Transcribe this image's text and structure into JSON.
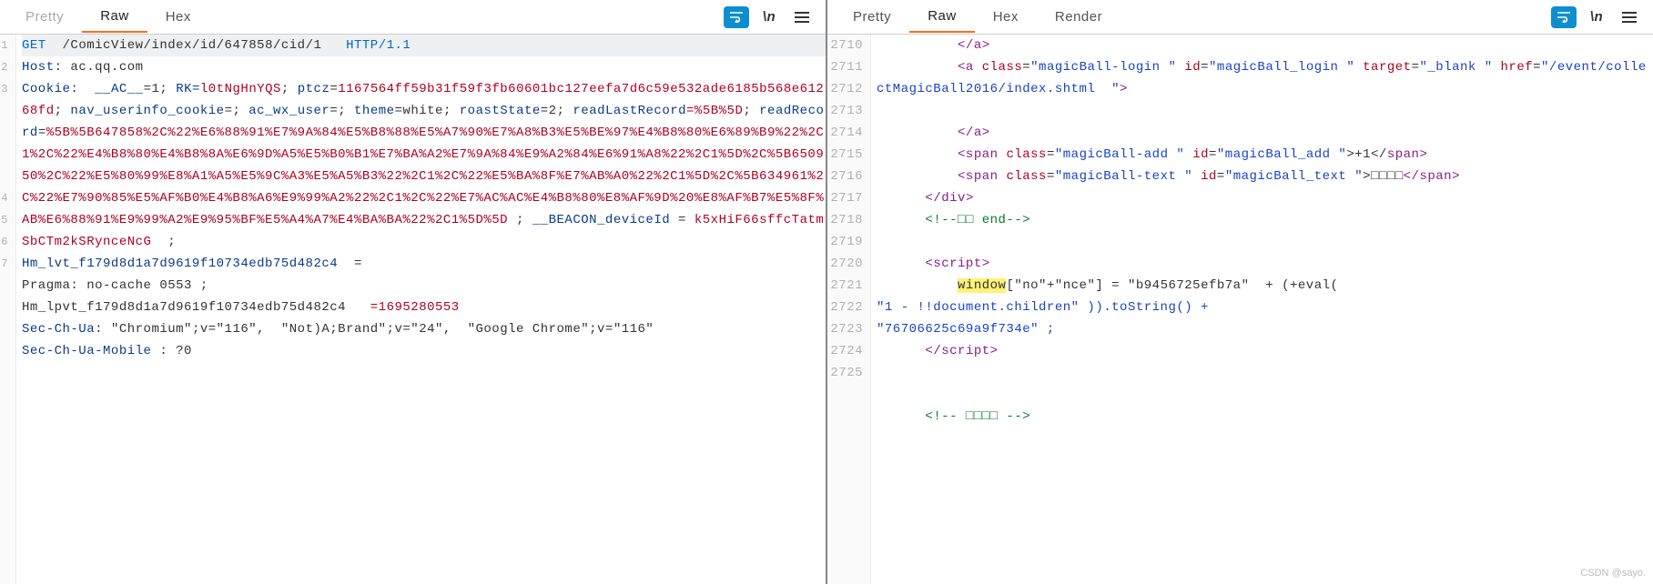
{
  "left": {
    "tabs": {
      "pretty": "Pretty",
      "raw": "Raw",
      "hex": "Hex"
    },
    "icons": {
      "wrap": "wrap-icon",
      "newline": "\\n",
      "menu": "☰"
    },
    "gutter": [
      "1",
      "2",
      "3",
      "4",
      "5",
      "6",
      "7"
    ],
    "req": {
      "method": "GET",
      "path": "/ComicView/index/id/647858/cid/1",
      "proto": "HTTP/1.1"
    },
    "headers": {
      "host_k": "Host",
      "host_v": "ac.qq.com",
      "cookie_k": "Cookie",
      "cookie_ac_k": "__AC__",
      "cookie_ac_v": "=1",
      "cookie_rk_k": "RK=",
      "cookie_rk_v": "l0tNgHnYQS",
      "cookie_ptcz_k": "ptcz",
      "cookie_ptcz_v": "1167564ff59b31f59f3fb60601bc127eefa7d6c59e532ade6185b568e61268fd",
      "cookie_nav_k": "nav_userinfo_cookie",
      "cookie_nav_v": "=;",
      "cookie_acwx_k": "ac_wx_user",
      "cookie_acwx_v": "=;",
      "cookie_theme_k": "theme",
      "cookie_theme_v": "=white",
      "cookie_roast_k": "roastState",
      "cookie_roast_v": "=2",
      "cookie_rlr_k": "readLastRecord",
      "cookie_rlr_v": "=%5B%5D",
      "cookie_rr_k": "readRecord",
      "cookie_rr_v": "%5B%5B647858%2C%22%E6%88%91%E7%9A%84%E5%B8%88%E5%A7%90%E7%A8%B3%E5%BE%97%E4%B8%80%E6%89%B9%22%2C1%2C%22%E4%B8%80%E4%B8%8A%E6%9D%A5%E5%B0%B1%E7%BA%A2%E7%9A%84%E9%A2%84%E6%91%A8%22%2C1%5D%2C%5B650950%2C%22%E5%80%99%E8%A1%A5%E5%9C%A3%E5%A5%B3%22%2C1%2C%22%E5%BA%8F%E7%AB%A0%22%2C1%5D%2C%5B634961%2C%22%E7%90%85%E5%AF%B0%E4%B8%A6%E9%99%A2%22%2C1%2C%22%E7%AC%AC%E4%B8%80%E8%AF%9D%20%E8%AF%B7%E5%8F%AB%E6%88%91%E9%99%A2%E9%95%BF%E5%A4%A7%E4%BA%BA%22%2C1%5D%5D",
      "beacon_k": "__BEACON_deviceId",
      "beacon_v": "k5xHiF66sffcTatmSbCTm2kSRynceNcG",
      "hm_lvt_k": "Hm_lvt_f179d8d1a7d9619f10734edb75d482c4",
      "hm_lvt_v": "=",
      "pragma_line": "Pragma: no-cache 0553 ;",
      "hm_lpvt_line_k": "Hm_lpvt_f179d8d1a7d9619f10734edb75d482c4",
      "hm_lpvt_line_v": "=1695280553",
      "overlay_line": "",
      "sec_ua_k": "Sec-Ch-Ua",
      "sec_ua_v": "\"Chromium\";v=\"116\",  \"Not)A;Brand\";v=\"24\",  \"Google Chrome\";v=\"116\"",
      "sec_ua_m_k": "Sec-Ch-Ua-Mobile",
      "sec_ua_m_v": "?0"
    }
  },
  "right": {
    "tabs": {
      "pretty": "Pretty",
      "raw": "Raw",
      "hex": "Hex",
      "render": "Render"
    },
    "icons": {
      "wrap": "wrap-icon",
      "newline": "\\n",
      "menu": "☰"
    },
    "gutter": [
      "2710",
      "2711",
      "2712",
      "2713",
      "2714",
      "2715",
      "2716",
      "2717",
      "2718",
      "2719",
      "2720",
      "2721",
      "2722",
      "2723",
      "2724",
      "2725"
    ],
    "html": {
      "a_close": "</",
      "a_close_tag": "a",
      "a_close_end": ">",
      "a_open": "<",
      "a_tag": "a",
      "a_class_k": "class",
      "a_class_v": "\"magicBall-login \"",
      "a_id_k": "id",
      "a_id_v": "\"magicBall_login \"",
      "a_target_k": "target",
      "a_target_v": "\"_blank \"",
      "a_href_k": "href",
      "a_href_v": "\"/event/collectMagicBall2016/index.shtml  \"",
      "a_end": ">",
      "span_open": "<",
      "span_tag": "span",
      "span_add_class_v": "\"magicBall-add \"",
      "span_add_id_v": "\"magicBall_add \"",
      "span_add_text": ">+1</",
      "span_close_tag": "span",
      "span_close_end": ">",
      "span_text_class_v": "\"magicBall-text \"",
      "span_text_id_v": "\"magicBall_text \"",
      "span_text_text": "□□□□",
      "div_close": "</",
      "div_tag": "div",
      "div_close_end": ">",
      "comment_end": "<!--□□ end-->",
      "script_open": "<",
      "script_tag": "script",
      "script_end": ">",
      "window_hl": "window",
      "js_1": "[\"no\"+\"nce\"] = \"b9456725efb7a\"  + (+eval(",
      "js_2": "\"1 - !!document.children\" )).toString() + ",
      "js_3": "\"76706625c69a9f734e\" ;",
      "script_close": "</",
      "script_close_end": ">",
      "comment_last": "<!-- □□□□ -->"
    }
  },
  "watermark": "CSDN @sayo."
}
